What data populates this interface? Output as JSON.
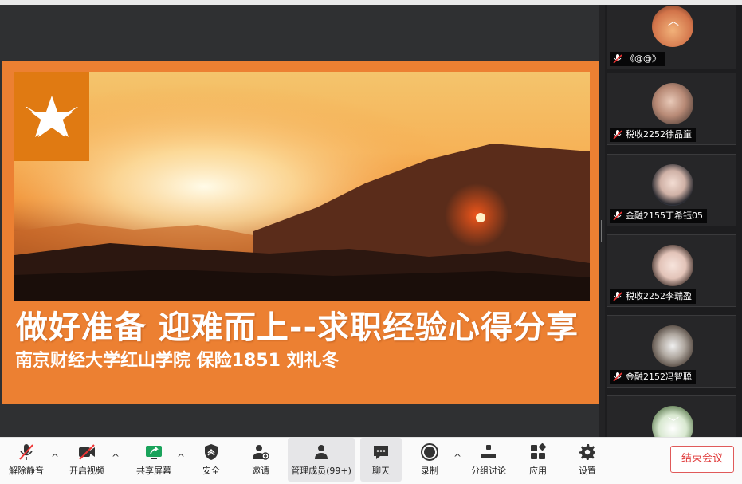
{
  "slide": {
    "title": "做好准备  迎难而上--求职经验心得分享",
    "subtitle": "南京财经大学红山学院   保险1851   刘礼冬"
  },
  "gallery": {
    "participants": [
      {
        "name": "《@@》"
      },
      {
        "name": "税收2252徐晶童"
      },
      {
        "name": "金融2155丁希钰05"
      },
      {
        "name": "税收2252李瑞盈"
      },
      {
        "name": "金融2152冯智聪"
      },
      {
        "name": ""
      }
    ]
  },
  "toolbar": {
    "unmute": "解除静音",
    "start_video": "开启视频",
    "share_screen": "共享屏幕",
    "security": "安全",
    "invite": "邀请",
    "manage_members": "管理成员(99+)",
    "chat": "聊天",
    "record": "录制",
    "breakout": "分组讨论",
    "apps": "应用",
    "settings": "设置",
    "end_meeting": "结束会议"
  },
  "colors": {
    "slide_orange": "#ec8032",
    "end_red": "#e03c3c",
    "share_green": "#1aa35b"
  }
}
